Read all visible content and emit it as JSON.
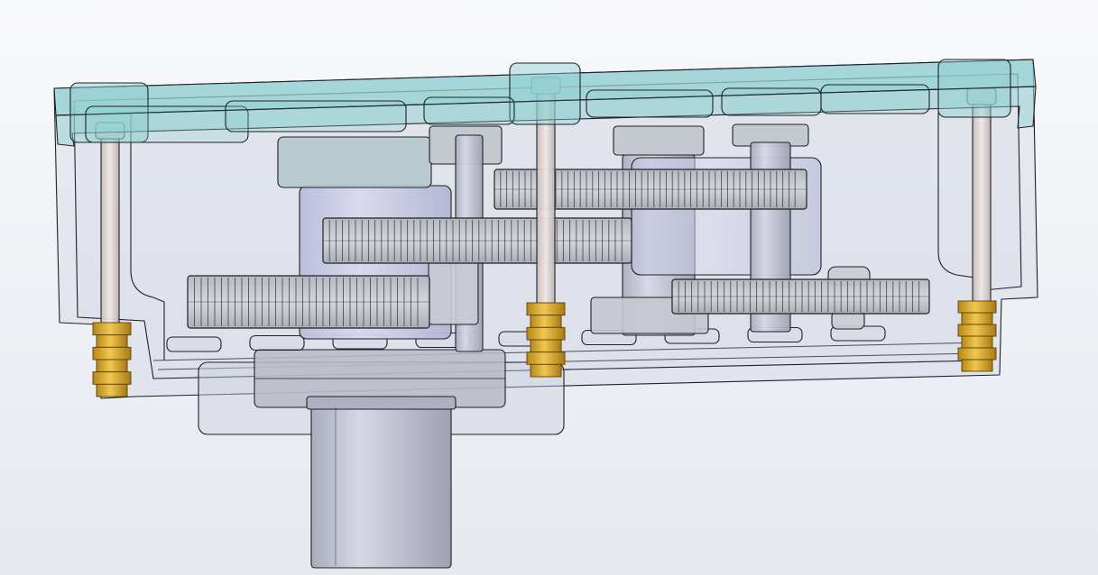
{
  "scene": {
    "background_top": "#f8f9fc",
    "background_bottom": "#e6e8ee",
    "edge_color": "#1e2126",
    "housing_fill": "#cdd0e0",
    "lid_fill": "#8fcfd1",
    "gear_fill": "#bfc2c8",
    "shaft_fill": "#c9cad2",
    "cylinder_fill": "#c4c6e2",
    "output_shaft_fill": "#b9bccc",
    "insert_fill": "#d4a52c",
    "standoff_fill": "#ddd2cf"
  },
  "parts": [
    {
      "name": "transparent-housing"
    },
    {
      "name": "tinted-lid"
    },
    {
      "name": "large-gear"
    },
    {
      "name": "middle-gear"
    },
    {
      "name": "upper-gear"
    },
    {
      "name": "right-gear"
    },
    {
      "name": "output-shaft"
    },
    {
      "name": "threaded-insert-left"
    },
    {
      "name": "threaded-insert-center"
    },
    {
      "name": "threaded-insert-right"
    }
  ]
}
